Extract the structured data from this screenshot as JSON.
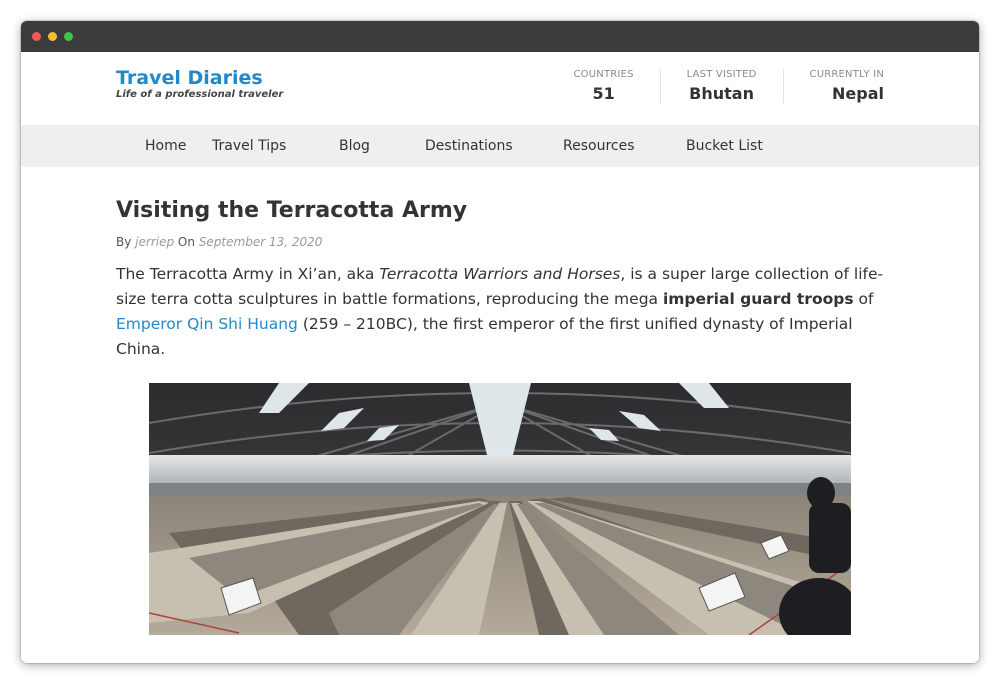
{
  "brand": {
    "title": "Travel Diaries",
    "tagline": "Life of a professional traveler"
  },
  "stats": [
    {
      "label": "COUNTRIES",
      "value": "51"
    },
    {
      "label": "LAST VISITED",
      "value": "Bhutan"
    },
    {
      "label": "CURRENTLY IN",
      "value": "Nepal"
    }
  ],
  "nav": [
    "Home",
    "Travel Tips",
    "Blog",
    "Destinations",
    "Resources",
    "Bucket List"
  ],
  "post": {
    "title": "Visiting the Terracotta Army",
    "by": "By",
    "author": "jerriep",
    "on": "On",
    "date": "September 13, 2020",
    "p1": "The Terracotta Army in Xi’an, aka ",
    "p1_italic": "Terracotta Warriors and Horses",
    "p2": ", is a super large collection of life-size terra cotta sculptures in battle formations, reproducing the mega ",
    "p2_bold": "imperial guard troops",
    "p3": " of ",
    "link": "Emperor Qin Shi Huang",
    "p4": " (259 – 210BC), the first emperor of the first unified dynasty of Imperial China."
  },
  "colors": {
    "brand": "#2188c9",
    "nav_bg": "#efefef",
    "titlebar": "#3b3b3b"
  }
}
